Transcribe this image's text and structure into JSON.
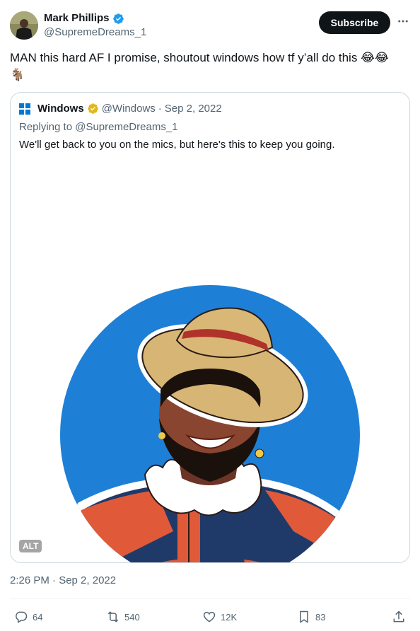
{
  "author": {
    "display_name": "Mark Phillips",
    "handle": "@SupremeDreams_1",
    "verified_icon": "verified-badge-icon"
  },
  "header": {
    "subscribe_label": "Subscribe",
    "more_icon": "more-icon"
  },
  "tweet": {
    "text": "MAN this hard AF I promise, shoutout windows how tf y’all do this",
    "emojis": [
      "😂",
      "😂",
      "🐐"
    ]
  },
  "quote": {
    "name": "Windows",
    "handle": "@Windows",
    "separator": "·",
    "date": "Sep 2, 2022",
    "replying_prefix": "Replying to",
    "replying_handle": "@SupremeDreams_1",
    "text": "We'll get back to you on the mics, but here's this to keep you going.",
    "alt_label": "ALT"
  },
  "timestamp": "2:26 PM · Sep 2, 2022",
  "actions": {
    "replies": "64",
    "reposts": "540",
    "likes": "12K",
    "bookmarks": "83"
  },
  "colors": {
    "accent_blue": "#1d9bf0",
    "gold_badge": "#e2b719",
    "windows_blue": "#0078d4",
    "artwork_circle": "#1e7fd6"
  }
}
